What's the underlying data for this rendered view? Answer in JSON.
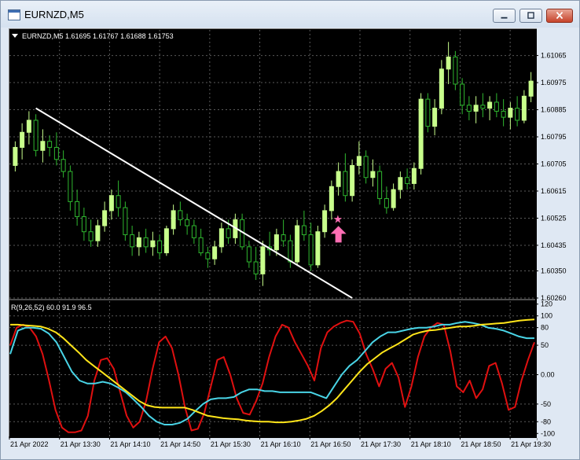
{
  "window": {
    "title": "EURNZD,M5",
    "buttons": [
      {
        "name": "minimize-button",
        "icon": "minimize-icon"
      },
      {
        "name": "maximize-button",
        "icon": "maximize-icon"
      },
      {
        "name": "close-button",
        "icon": "close-icon"
      }
    ]
  },
  "chart_header": {
    "symbol_line": "EURNZD,M5  1.61695 1.61767 1.61688 1.61753",
    "indicator_line": "R(9,26,52) 60.0 91.9 96.5"
  },
  "colors": {
    "background": "#000000",
    "grid": "#5a5a5a",
    "candle_up": "#c8ff8c",
    "candle_down": "#2fb82f",
    "trendline": "#ffffff",
    "line_fast": "#e01010",
    "line_mid": "#49d4e6",
    "line_slow": "#ffe51a",
    "marker": "#ff6eb4"
  },
  "chart_data": [
    {
      "type": "candlestick",
      "symbol": "EURNZD",
      "timeframe": "M5",
      "ylim": [
        1.6026,
        1.6115
      ],
      "y_ticks": [
        "1.61065",
        "1.60975",
        "1.60885",
        "1.60795",
        "1.60705",
        "1.60615",
        "1.60525",
        "1.60435",
        "1.60350",
        "1.60260"
      ],
      "candles": [
        {
          "o": 1.607,
          "h": 1.6078,
          "l": 1.6068,
          "c": 1.6076
        },
        {
          "o": 1.6076,
          "h": 1.6084,
          "l": 1.6072,
          "c": 1.6081
        },
        {
          "o": 1.6081,
          "h": 1.6088,
          "l": 1.6077,
          "c": 1.6085
        },
        {
          "o": 1.6085,
          "h": 1.6087,
          "l": 1.6073,
          "c": 1.6075
        },
        {
          "o": 1.6075,
          "h": 1.6082,
          "l": 1.6071,
          "c": 1.6078
        },
        {
          "o": 1.6078,
          "h": 1.608,
          "l": 1.6073,
          "c": 1.6076
        },
        {
          "o": 1.6076,
          "h": 1.6081,
          "l": 1.607,
          "c": 1.6072
        },
        {
          "o": 1.6072,
          "h": 1.6075,
          "l": 1.6066,
          "c": 1.6068
        },
        {
          "o": 1.6068,
          "h": 1.607,
          "l": 1.6055,
          "c": 1.6058
        },
        {
          "o": 1.6058,
          "h": 1.6062,
          "l": 1.605,
          "c": 1.6053
        },
        {
          "o": 1.6053,
          "h": 1.6056,
          "l": 1.6045,
          "c": 1.6048
        },
        {
          "o": 1.6048,
          "h": 1.6052,
          "l": 1.6043,
          "c": 1.6045
        },
        {
          "o": 1.6045,
          "h": 1.6052,
          "l": 1.6043,
          "c": 1.605
        },
        {
          "o": 1.605,
          "h": 1.6058,
          "l": 1.6048,
          "c": 1.6055
        },
        {
          "o": 1.6055,
          "h": 1.6062,
          "l": 1.6052,
          "c": 1.606
        },
        {
          "o": 1.606,
          "h": 1.6065,
          "l": 1.6053,
          "c": 1.6056
        },
        {
          "o": 1.6056,
          "h": 1.6058,
          "l": 1.6045,
          "c": 1.6047
        },
        {
          "o": 1.6047,
          "h": 1.605,
          "l": 1.604,
          "c": 1.6043
        },
        {
          "o": 1.6043,
          "h": 1.6048,
          "l": 1.604,
          "c": 1.6046
        },
        {
          "o": 1.6046,
          "h": 1.6049,
          "l": 1.6041,
          "c": 1.6043
        },
        {
          "o": 1.6043,
          "h": 1.6048,
          "l": 1.604,
          "c": 1.6045
        },
        {
          "o": 1.6045,
          "h": 1.6047,
          "l": 1.6039,
          "c": 1.6041
        },
        {
          "o": 1.6041,
          "h": 1.605,
          "l": 1.604,
          "c": 1.6049
        },
        {
          "o": 1.6049,
          "h": 1.6057,
          "l": 1.6047,
          "c": 1.6055
        },
        {
          "o": 1.6055,
          "h": 1.6058,
          "l": 1.605,
          "c": 1.6052
        },
        {
          "o": 1.6052,
          "h": 1.6054,
          "l": 1.6047,
          "c": 1.605
        },
        {
          "o": 1.605,
          "h": 1.6052,
          "l": 1.6044,
          "c": 1.6046
        },
        {
          "o": 1.6046,
          "h": 1.6049,
          "l": 1.604,
          "c": 1.6041
        },
        {
          "o": 1.6041,
          "h": 1.6043,
          "l": 1.6036,
          "c": 1.6039
        },
        {
          "o": 1.6039,
          "h": 1.6045,
          "l": 1.6037,
          "c": 1.6043
        },
        {
          "o": 1.6043,
          "h": 1.6051,
          "l": 1.6041,
          "c": 1.6049
        },
        {
          "o": 1.6049,
          "h": 1.6052,
          "l": 1.6044,
          "c": 1.6046
        },
        {
          "o": 1.6046,
          "h": 1.6054,
          "l": 1.6044,
          "c": 1.6052
        },
        {
          "o": 1.6052,
          "h": 1.6054,
          "l": 1.6042,
          "c": 1.6043
        },
        {
          "o": 1.6043,
          "h": 1.6045,
          "l": 1.6036,
          "c": 1.6038
        },
        {
          "o": 1.6038,
          "h": 1.6043,
          "l": 1.6032,
          "c": 1.6034
        },
        {
          "o": 1.6034,
          "h": 1.6045,
          "l": 1.603,
          "c": 1.6043
        },
        {
          "o": 1.6043,
          "h": 1.6048,
          "l": 1.604,
          "c": 1.6042
        },
        {
          "o": 1.6042,
          "h": 1.6049,
          "l": 1.604,
          "c": 1.6047
        },
        {
          "o": 1.6047,
          "h": 1.6052,
          "l": 1.6043,
          "c": 1.6045
        },
        {
          "o": 1.6045,
          "h": 1.6047,
          "l": 1.6036,
          "c": 1.6038
        },
        {
          "o": 1.6038,
          "h": 1.6052,
          "l": 1.6037,
          "c": 1.605
        },
        {
          "o": 1.605,
          "h": 1.6055,
          "l": 1.6045,
          "c": 1.6047
        },
        {
          "o": 1.6047,
          "h": 1.6051,
          "l": 1.6035,
          "c": 1.6037
        },
        {
          "o": 1.6037,
          "h": 1.605,
          "l": 1.6036,
          "c": 1.6048
        },
        {
          "o": 1.6048,
          "h": 1.6057,
          "l": 1.6046,
          "c": 1.6055
        },
        {
          "o": 1.6055,
          "h": 1.6065,
          "l": 1.6052,
          "c": 1.6063
        },
        {
          "o": 1.6063,
          "h": 1.6071,
          "l": 1.606,
          "c": 1.6068
        },
        {
          "o": 1.6068,
          "h": 1.6074,
          "l": 1.6058,
          "c": 1.606
        },
        {
          "o": 1.606,
          "h": 1.6072,
          "l": 1.6058,
          "c": 1.607
        },
        {
          "o": 1.607,
          "h": 1.6078,
          "l": 1.6067,
          "c": 1.6073
        },
        {
          "o": 1.6073,
          "h": 1.6075,
          "l": 1.6064,
          "c": 1.6066
        },
        {
          "o": 1.6066,
          "h": 1.6072,
          "l": 1.6063,
          "c": 1.6068
        },
        {
          "o": 1.6068,
          "h": 1.607,
          "l": 1.6057,
          "c": 1.6059
        },
        {
          "o": 1.6059,
          "h": 1.6063,
          "l": 1.6054,
          "c": 1.6056
        },
        {
          "o": 1.6056,
          "h": 1.6064,
          "l": 1.6055,
          "c": 1.6062
        },
        {
          "o": 1.6062,
          "h": 1.6068,
          "l": 1.6059,
          "c": 1.6066
        },
        {
          "o": 1.6066,
          "h": 1.6069,
          "l": 1.6062,
          "c": 1.6064
        },
        {
          "o": 1.6064,
          "h": 1.6071,
          "l": 1.6062,
          "c": 1.6069
        },
        {
          "o": 1.6069,
          "h": 1.6094,
          "l": 1.6067,
          "c": 1.6092
        },
        {
          "o": 1.6092,
          "h": 1.6094,
          "l": 1.6081,
          "c": 1.6083
        },
        {
          "o": 1.6083,
          "h": 1.6092,
          "l": 1.608,
          "c": 1.6089
        },
        {
          "o": 1.6089,
          "h": 1.6105,
          "l": 1.6087,
          "c": 1.6102
        },
        {
          "o": 1.6102,
          "h": 1.6111,
          "l": 1.6097,
          "c": 1.6106
        },
        {
          "o": 1.6106,
          "h": 1.6108,
          "l": 1.6095,
          "c": 1.6097
        },
        {
          "o": 1.6097,
          "h": 1.6099,
          "l": 1.6087,
          "c": 1.609
        },
        {
          "o": 1.609,
          "h": 1.6093,
          "l": 1.6085,
          "c": 1.6088
        },
        {
          "o": 1.6088,
          "h": 1.6093,
          "l": 1.6084,
          "c": 1.609
        },
        {
          "o": 1.609,
          "h": 1.6094,
          "l": 1.6086,
          "c": 1.6089
        },
        {
          "o": 1.6089,
          "h": 1.6093,
          "l": 1.6085,
          "c": 1.6091
        },
        {
          "o": 1.6091,
          "h": 1.6094,
          "l": 1.6086,
          "c": 1.6088
        },
        {
          "o": 1.6088,
          "h": 1.6092,
          "l": 1.6083,
          "c": 1.6086
        },
        {
          "o": 1.6086,
          "h": 1.6091,
          "l": 1.6082,
          "c": 1.6089
        },
        {
          "o": 1.6089,
          "h": 1.6093,
          "l": 1.6083,
          "c": 1.6085
        },
        {
          "o": 1.6085,
          "h": 1.6095,
          "l": 1.6084,
          "c": 1.6093
        },
        {
          "o": 1.6093,
          "h": 1.6101,
          "l": 1.6091,
          "c": 1.6098
        }
      ],
      "trendline": {
        "start": {
          "bar": 3,
          "price": 1.6089
        },
        "end": {
          "bar": 49,
          "price": 1.6026
        }
      },
      "signal_marker": {
        "bar": 47,
        "price": 1.6052,
        "star": "★",
        "arrow": "up"
      }
    },
    {
      "type": "line",
      "indicator": "R(9,26,52)",
      "ylim": [
        -105,
        125
      ],
      "y_ticks": [
        "120",
        "100",
        "80",
        "50",
        "0.00",
        "-50",
        "-80",
        "-100"
      ],
      "x_tick_labels": [
        "21 Apr 2022",
        "21 Apr 13:30",
        "21 Apr 14:10",
        "21 Apr 14:50",
        "21 Apr 15:30",
        "21 Apr 16:10",
        "21 Apr 16:50",
        "21 Apr 17:30",
        "21 Apr 18:10",
        "21 Apr 18:50",
        "21 Apr 19:30"
      ],
      "series": [
        {
          "color": "#e01010",
          "values": [
            50,
            80,
            85,
            80,
            65,
            35,
            -10,
            -60,
            -90,
            -98,
            -98,
            -95,
            -70,
            -10,
            25,
            28,
            10,
            -30,
            -70,
            -90,
            -80,
            -45,
            10,
            55,
            65,
            45,
            0,
            -55,
            -95,
            -92,
            -65,
            -20,
            25,
            30,
            0,
            -40,
            -65,
            -68,
            -45,
            -15,
            30,
            65,
            85,
            80,
            55,
            35,
            15,
            -10,
            45,
            72,
            82,
            88,
            92,
            90,
            70,
            35,
            10,
            -20,
            10,
            20,
            -5,
            -55,
            -20,
            30,
            65,
            80,
            88,
            85,
            40,
            -20,
            -30,
            -10,
            -40,
            -25,
            15,
            20,
            -15,
            -60,
            -55,
            -10,
            25,
            55
          ]
        },
        {
          "color": "#49d4e6",
          "values": [
            35,
            75,
            80,
            80,
            78,
            70,
            55,
            30,
            5,
            -10,
            -15,
            -15,
            -12,
            -15,
            -22,
            -30,
            -42,
            -55,
            -70,
            -80,
            -85,
            -85,
            -82,
            -75,
            -62,
            -50,
            -42,
            -40,
            -40,
            -38,
            -30,
            -25,
            -25,
            -28,
            -28,
            -30,
            -30,
            -30,
            -30,
            -30,
            -35,
            -40,
            -20,
            0,
            15,
            25,
            40,
            55,
            65,
            72,
            72,
            75,
            78,
            80,
            80,
            82,
            85,
            85,
            88,
            90,
            88,
            85,
            80,
            78,
            75,
            70,
            65,
            62,
            62
          ]
        },
        {
          "color": "#ffe51a",
          "values": [
            85,
            85,
            84,
            83,
            82,
            78,
            72,
            62,
            50,
            38,
            25,
            15,
            5,
            -5,
            -15,
            -25,
            -35,
            -45,
            -52,
            -55,
            -56,
            -56,
            -56,
            -56,
            -60,
            -65,
            -70,
            -72,
            -74,
            -75,
            -76,
            -78,
            -79,
            -80,
            -80,
            -81,
            -81,
            -80,
            -78,
            -75,
            -70,
            -62,
            -52,
            -40,
            -25,
            -10,
            5,
            18,
            28,
            38,
            45,
            52,
            60,
            68,
            72,
            75,
            76,
            78,
            80,
            82,
            82,
            83,
            85,
            86,
            87,
            88,
            90,
            92,
            93,
            94
          ]
        }
      ]
    }
  ]
}
